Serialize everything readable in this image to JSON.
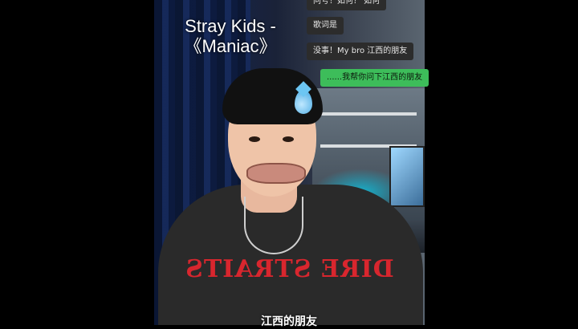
{
  "overlay": {
    "title_line1": "Stray Kids -",
    "title_line2": "《Maniac》"
  },
  "chat": {
    "messages": [
      {
        "text": "问号！如何？ 如何",
        "side": "left"
      },
      {
        "text": "歌词是",
        "side": "left"
      },
      {
        "text": "没事！My bro  江西的朋友",
        "side": "left"
      },
      {
        "text": "......我帮你问下江西的朋友",
        "side": "right"
      }
    ]
  },
  "shirt": {
    "print_text": "DIRE STRAITS"
  },
  "subtitle": {
    "text": "江西的朋友"
  },
  "colors": {
    "outgoing_bubble": "#3dbd5a",
    "incoming_bubble": "#2c2c2c",
    "shirt_print": "#d8262e"
  },
  "icons": {
    "sweat_drop": "sweat-drop-emoji"
  }
}
